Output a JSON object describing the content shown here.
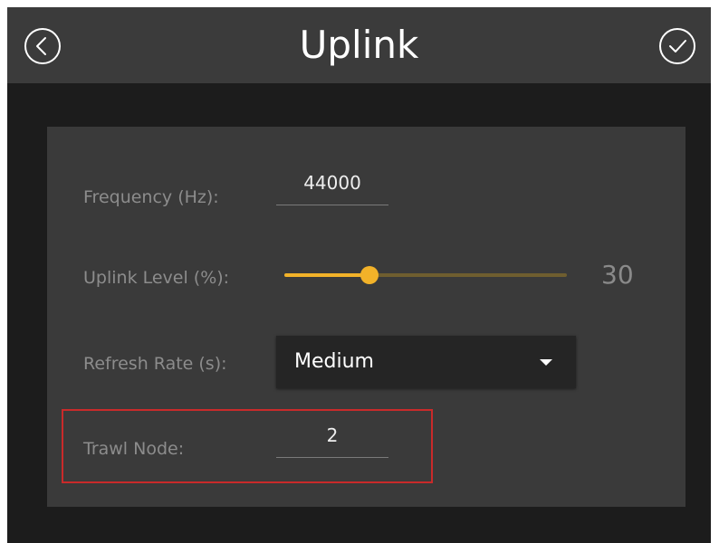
{
  "header": {
    "title": "Uplink",
    "back_icon": "back-circle-icon",
    "confirm_icon": "check-circle-icon"
  },
  "form": {
    "frequency": {
      "label": "Frequency (Hz):",
      "value": "44000"
    },
    "uplink_level": {
      "label": "Uplink Level (%):",
      "value": 30,
      "value_text": "30",
      "min": 0,
      "max": 100
    },
    "refresh_rate": {
      "label": "Refresh Rate (s):",
      "selected": "Medium"
    },
    "trawl_node": {
      "label": "Trawl Node:",
      "value": "2"
    }
  },
  "colors": {
    "accent": "#f2b229",
    "highlight": "#c92a2a",
    "header_bg": "#3b3b3b",
    "panel_bg": "#3a3a3a"
  }
}
